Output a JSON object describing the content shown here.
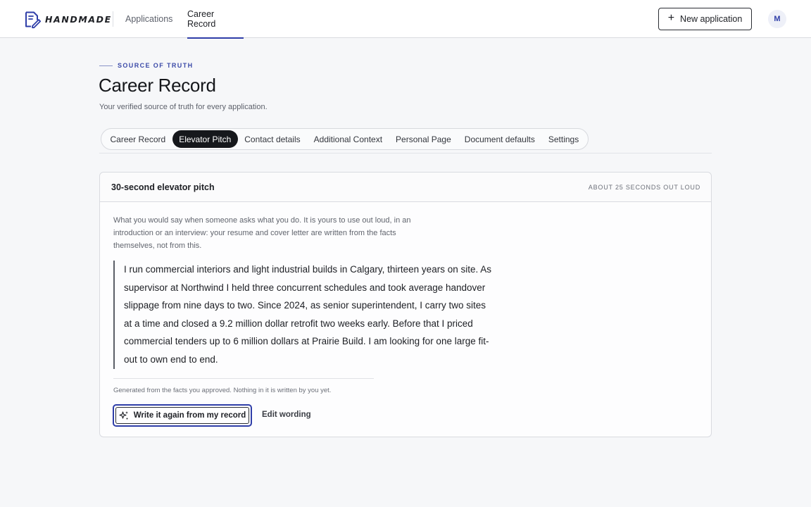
{
  "app": {
    "logo_text": "HANDMADE",
    "accent_color": "#2f3ea8"
  },
  "topnav": {
    "applications": "Applications",
    "career_record": "Career Record",
    "active": "career_record"
  },
  "header_actions": {
    "new_application": "New application",
    "avatar_initial": "M"
  },
  "page": {
    "eyebrow": "SOURCE OF TRUTH",
    "title": "Career Record",
    "subtitle": "Your verified source of truth for every application."
  },
  "tabs": [
    {
      "label": "Career Record",
      "active": false
    },
    {
      "label": "Elevator Pitch",
      "active": true
    },
    {
      "label": "Contact details",
      "active": false
    },
    {
      "label": "Additional Context",
      "active": false
    },
    {
      "label": "Personal Page",
      "active": false
    },
    {
      "label": "Document defaults",
      "active": false
    },
    {
      "label": "Settings",
      "active": false
    }
  ],
  "card": {
    "title": "30-second elevator pitch",
    "meta": "ABOUT 25 SECONDS OUT LOUD",
    "intro": "What you would say when someone asks what you do. It is yours to use out loud, in an introduction or an interview: your resume and cover letter are written from the facts themselves, not from this.",
    "pitch": "I run commercial interiors and light industrial builds in Calgary, thirteen years on site. As supervisor at Northwind I held three concurrent schedules and took average handover slippage from nine days to two. Since 2024, as senior superintendent, I carry two sites at a time and closed a 9.2 million dollar retrofit two weeks early. Before that I priced commercial tenders up to 6 million dollars at Prairie Build. I am looking for one large fit-out to own end to end.",
    "generated_note": "Generated from the facts you approved. Nothing in it is written by you yet.",
    "rewrite_button": "Write it again from my record",
    "edit_button": "Edit wording"
  }
}
